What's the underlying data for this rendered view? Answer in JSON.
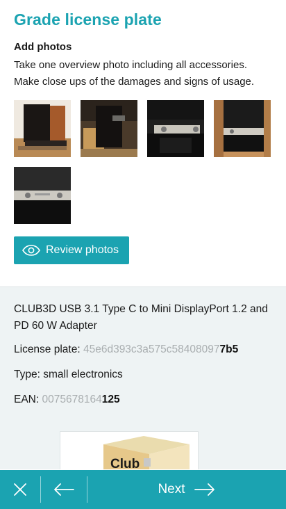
{
  "header": {
    "title": "Grade license plate"
  },
  "photos_section": {
    "title": "Add photos",
    "instructions": "Take one overview photo including all accessories. Make close ups of the damages and signs of usage.",
    "photo_count": 5
  },
  "review_button": {
    "label": "Review photos",
    "icon": "eye-icon"
  },
  "product": {
    "name": "CLUB3D USB 3.1 Type C to Mini DisplayPort 1.2 and PD 60 W Adapter",
    "license_plate_label": "License plate: ",
    "license_plate_prefix": "45e6d393c3a575c58408097",
    "license_plate_suffix": "7b5",
    "type_label": "Type: ",
    "type_value": "small electronics",
    "ean_label": "EAN: ",
    "ean_prefix": "0075678164",
    "ean_suffix": "125",
    "image_logo_text": "Club"
  },
  "bottom_bar": {
    "close_icon": "close-icon",
    "back_icon": "arrow-left-icon",
    "next_label": "Next",
    "next_icon": "arrow-right-icon"
  },
  "colors": {
    "accent": "#1ba3b1",
    "info_bg": "#eef3f4",
    "muted": "#a9aeb0"
  }
}
